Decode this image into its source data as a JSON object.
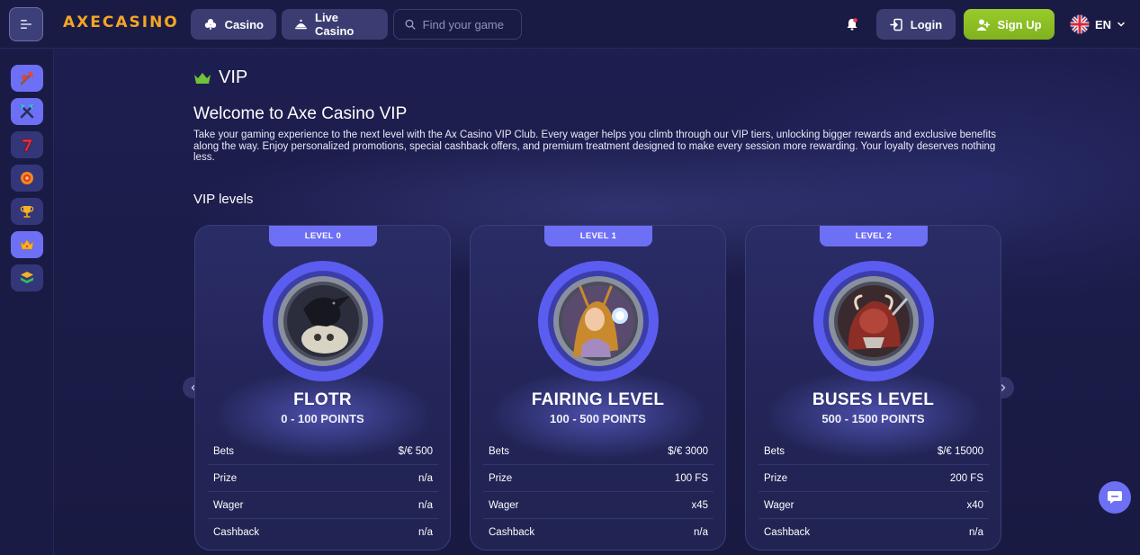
{
  "header": {
    "logo": "AXECASINO",
    "nav": [
      {
        "label": "Casino",
        "icon": "club-icon"
      },
      {
        "label": "Live Casino",
        "icon": "dealer-icon"
      }
    ],
    "search_placeholder": "Find your game",
    "login_label": "Login",
    "signup_label": "Sign Up",
    "language": "EN"
  },
  "sidebar": {
    "items": [
      "ax-icon",
      "crossed-axes-icon",
      "seven-icon",
      "chip-icon",
      "trophy-icon",
      "crown-icon",
      "stack-icon"
    ],
    "active": "crown-icon"
  },
  "page": {
    "section_title": "VIP",
    "welcome_title": "Welcome to Axe Casino VIP",
    "intro": "Take your gaming experience to the next level with the Ax Casino VIP Club. Every wager helps you climb through our VIP tiers, unlocking bigger rewards and exclusive benefits along the way. Enjoy personalized promotions, special cashback offers, and premium treatment designed to make every session more rewarding. Your loyalty deserves nothing less.",
    "levels_title": "VIP levels"
  },
  "levels": [
    {
      "badge": "LEVEL 0",
      "name": "FLOTR",
      "points": "0 - 100 POINTS",
      "rows": [
        {
          "label": "Bets",
          "value": "$/€ 500"
        },
        {
          "label": "Prize",
          "value": "n/a"
        },
        {
          "label": "Wager",
          "value": "n/a"
        },
        {
          "label": "Cashback",
          "value": "n/a"
        }
      ]
    },
    {
      "badge": "LEVEL 1",
      "name": "FAIRING LEVEL",
      "points": "100 - 500 POINTS",
      "rows": [
        {
          "label": "Bets",
          "value": "$/€ 3000"
        },
        {
          "label": "Prize",
          "value": "100 FS"
        },
        {
          "label": "Wager",
          "value": "x45"
        },
        {
          "label": "Cashback",
          "value": "n/a"
        }
      ]
    },
    {
      "badge": "LEVEL 2",
      "name": "BUSES LEVEL",
      "points": "500 - 1500 POINTS",
      "rows": [
        {
          "label": "Bets",
          "value": "$/€ 15000"
        },
        {
          "label": "Prize",
          "value": "200 FS"
        },
        {
          "label": "Wager",
          "value": "x40"
        },
        {
          "label": "Cashback",
          "value": "n/a"
        }
      ]
    }
  ],
  "colors": {
    "accent": "#6d6ff5",
    "signup": "#8cc026",
    "logo": "#f5a524",
    "background": "#1c1d4a"
  }
}
